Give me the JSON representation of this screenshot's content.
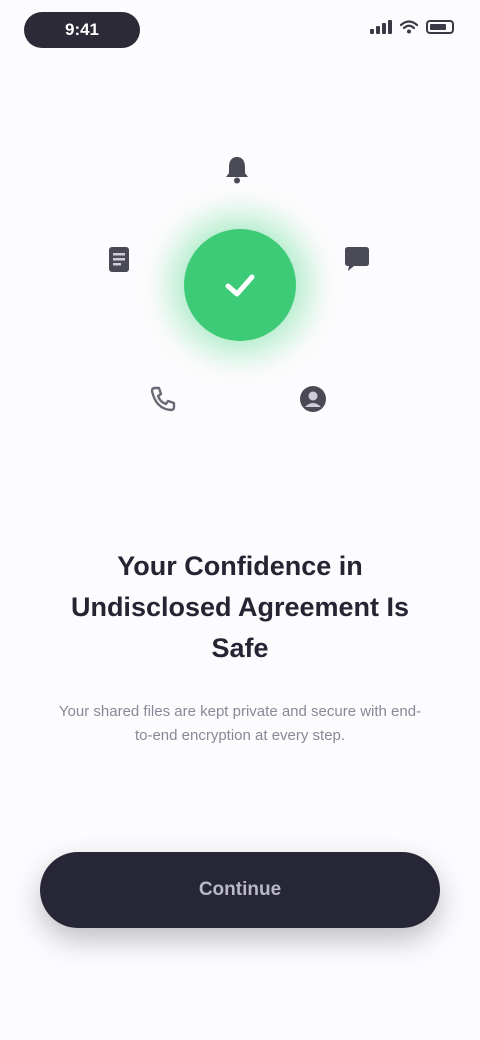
{
  "status_bar": {
    "time": "9:41"
  },
  "illustration": {
    "center_icon": "check-icon",
    "accent_color": "#3ecb78",
    "orbit_icons": [
      "bell-icon",
      "document-icon",
      "chat-icon",
      "phone-icon",
      "user-icon"
    ]
  },
  "content": {
    "headline": "Your Confidence in Undisclosed Agreement Is Safe",
    "description": "Your shared files are kept private and secure with end-to-end encryption at every step."
  },
  "cta": {
    "label": "Continue"
  },
  "colors": {
    "background": "#fcfbfd",
    "button": "#272636",
    "headline": "#262432",
    "body": "#8a8898"
  }
}
